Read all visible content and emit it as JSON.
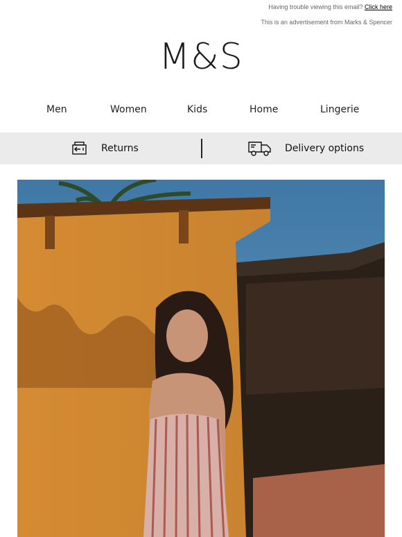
{
  "header": {
    "trouble_text": "Having trouble viewing this email?",
    "click_here_label": "Click here",
    "ad_notice": "This is an advertisement from Marks & Spencer"
  },
  "logo": {
    "text": "M&S"
  },
  "nav": {
    "items": [
      "Men",
      "Women",
      "Kids",
      "Home",
      "Lingerie"
    ]
  },
  "service_band": {
    "returns_label": "Returns",
    "returns_icon": "returns-box-icon",
    "delivery_label": "Delivery options",
    "delivery_icon": "delivery-truck-icon"
  },
  "colors": {
    "band_bg": "#ebebeb",
    "wall_ochre": "#d18a36",
    "sky_blue": "#4f86b0"
  }
}
